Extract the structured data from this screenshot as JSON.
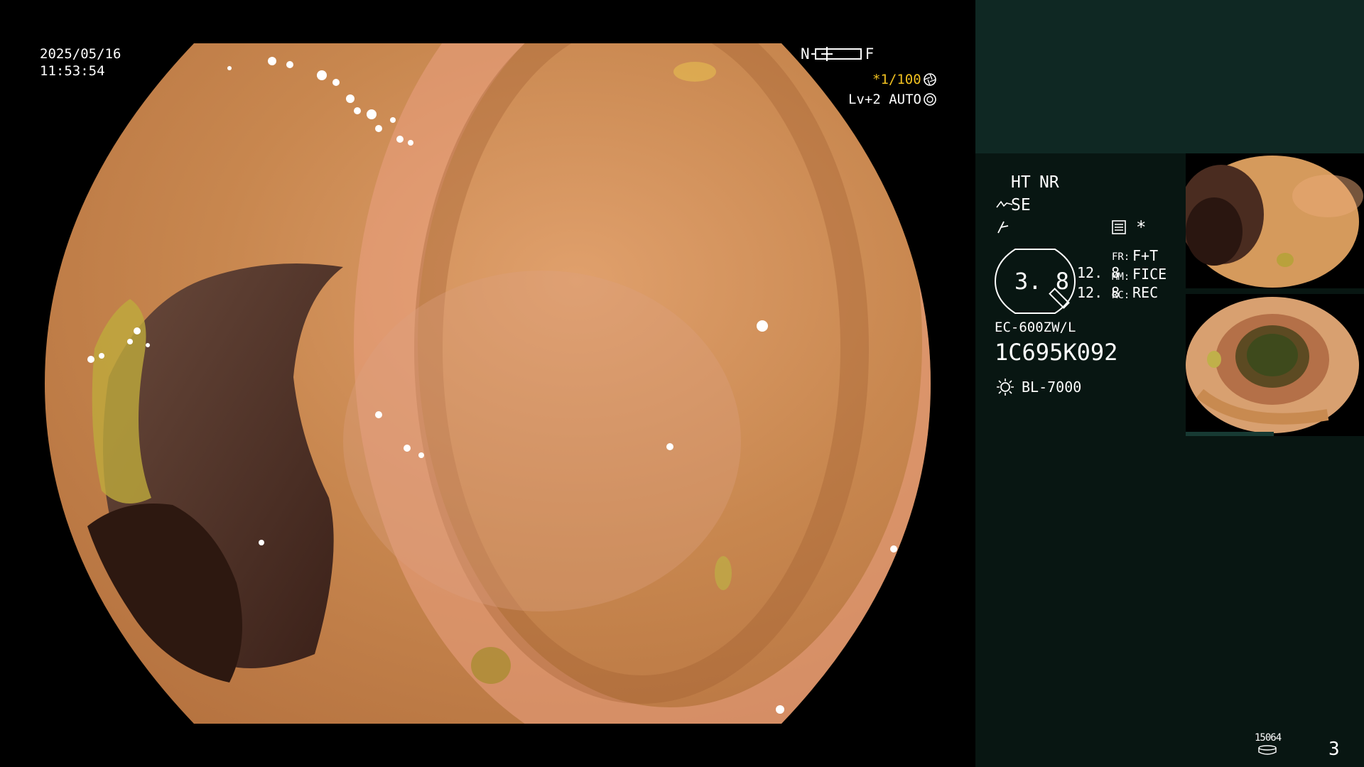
{
  "overlay": {
    "date": "2025/05/16",
    "time": "11:53:54",
    "near_far": {
      "near": "N",
      "far": "F"
    },
    "shutter": "*1/100",
    "level": "Lv+2 AUTO"
  },
  "panel": {
    "ht_label": "HT",
    "nr_label": "NR",
    "se_label": "SE",
    "asterisk": "*",
    "magnification": "3. 8",
    "value_1": "12. 8",
    "value_2": "12. 8",
    "fr_label": "FR:",
    "fr_value": "F+T",
    "mm_label": "MM:",
    "mm_value": "FICE",
    "rc_label": "RC:",
    "rc_value": "REC",
    "scope_model": "EC-600ZW/L",
    "serial": "1C695K092",
    "light_source": "BL-7000",
    "counter": "15064",
    "page_number": "3"
  },
  "colors": {
    "accent_yellow": "#f0c020",
    "panel_bg": "#081612",
    "panel_top_bg": "#0f2823",
    "mucosa": "#c98a55"
  },
  "icons": [
    "aperture-icon",
    "auto-iris-icon",
    "scope-icon",
    "cut-icon",
    "document-list-icon",
    "light-source-icon",
    "storage-icon"
  ]
}
